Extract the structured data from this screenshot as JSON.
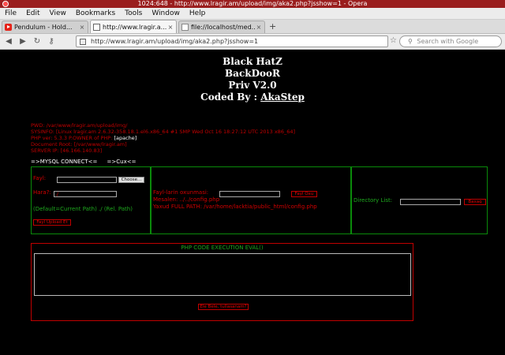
{
  "window": {
    "title": "1024:648 - http://www.lragir.am/upload/img/aka2.php?jsshow=1 - Opera"
  },
  "menu": [
    "File",
    "Edit",
    "View",
    "Bookmarks",
    "Tools",
    "Window",
    "Help"
  ],
  "tabs": [
    {
      "label": "Pendulum - Hold...",
      "icon": "youtube-icon",
      "active": false
    },
    {
      "label": "http://www.lragir.a...",
      "icon": "page-icon",
      "active": true
    },
    {
      "label": "file://localhost/med...",
      "icon": "file-icon",
      "active": false
    }
  ],
  "nav": {
    "url": "http://www.lragir.am/upload/img/aka2.php?jsshow=1",
    "search_placeholder": "Search with Google"
  },
  "page": {
    "title_lines": [
      "Black HatZ",
      "BackDooR",
      "Priv V2.0"
    ],
    "coded_by": "Coded By :",
    "author": "AkaStep",
    "info": {
      "pwd": "PWD: /var/www/lragir.am/upload/img/",
      "sysinfo": "SYSINFO: [Linux lragir.am 2.6.32-358.18.1.el6.x86_64 #1 SMP Wed Oct 16 18:27:12 UTC 2013 x86_64]",
      "php_owner_prefix": "PHP ver: 5.3.3 P.OWNER of PHP:",
      "php_owner_value": "[apache]",
      "docroot": "Document Root: [/var/www/lragir.am]",
      "server_ip": "SERVER IP: [46.166.140.83]"
    },
    "links": [
      "=>MYSQL CONNECT<=",
      "=>Cux<="
    ],
    "upload": {
      "file_label": "Fayl:",
      "choose_button": "Choose...",
      "where_label": "Hara?:",
      "where_value": "./",
      "hint": "(Default=Current Path) ./ (Rel. Path)",
      "submit_button": "Fayl Upload Et"
    },
    "read": {
      "label": "Fayl-larin oxunmasi:",
      "button": "Fayl Oxu",
      "example_label": "Mesalen: ../../config.php",
      "fullpath": "Yaxud FULL PATH: /var/home/lacktia/public_html/config.php"
    },
    "dir": {
      "label": "Directory List:",
      "button": "Baxaq"
    },
    "eval": {
      "title": "PHP CODE EXECUTION EVAL()",
      "button": "Ele Bele, tullasanam?"
    }
  },
  "colors": {
    "red": "#d20000",
    "green": "#1ea81e",
    "panel_border": "#0a8a0a",
    "titlebar": "#9a1e1e"
  }
}
